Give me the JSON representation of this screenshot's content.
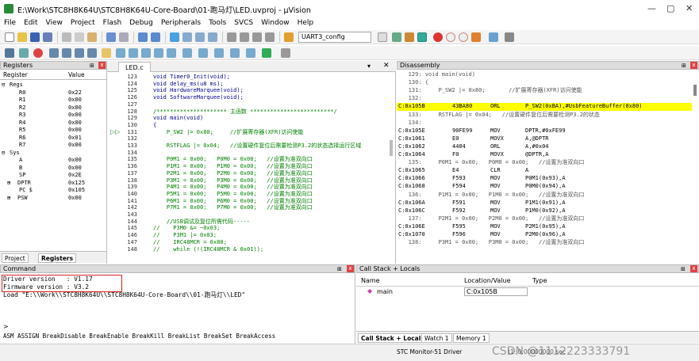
{
  "window": {
    "title": "E:\\Work\\STC8H8K64U\\STC8H8K64U-Core-Board\\01-跑马灯\\LED.uvproj - µVision"
  },
  "menu": [
    "File",
    "Edit",
    "View",
    "Project",
    "Flash",
    "Debug",
    "Peripherals",
    "Tools",
    "SVCS",
    "Window",
    "Help"
  ],
  "toolbar": {
    "target": "UART3_config"
  },
  "registers": {
    "title": "Registers",
    "col_register": "Register",
    "col_value": "Value",
    "rows": [
      {
        "name": "Regs",
        "value": "",
        "indent": 0,
        "prefix": "⊟"
      },
      {
        "name": "R0",
        "value": "0x22",
        "indent": 2
      },
      {
        "name": "R1",
        "value": "0x00",
        "indent": 2
      },
      {
        "name": "R2",
        "value": "0x00",
        "indent": 2
      },
      {
        "name": "R3",
        "value": "0x00",
        "indent": 2
      },
      {
        "name": "R4",
        "value": "0x00",
        "indent": 2
      },
      {
        "name": "R5",
        "value": "0x00",
        "indent": 2
      },
      {
        "name": "R6",
        "value": "0x01",
        "indent": 2
      },
      {
        "name": "R7",
        "value": "0x00",
        "indent": 2
      },
      {
        "name": "Sys",
        "value": "",
        "indent": 0,
        "prefix": "⊟"
      },
      {
        "name": "A",
        "value": "0x00",
        "indent": 2
      },
      {
        "name": "B",
        "value": "0x00",
        "indent": 2
      },
      {
        "name": "SP",
        "value": "0x2E",
        "indent": 2
      },
      {
        "name": "DPTR",
        "value": "0x125",
        "indent": 1,
        "prefix": "⊞"
      },
      {
        "name": "PC $",
        "value": "0x105",
        "indent": 2
      },
      {
        "name": "PSW",
        "value": "0x00",
        "indent": 1,
        "prefix": "⊞"
      }
    ],
    "tab_project": "Project",
    "tab_registers": "Registers"
  },
  "editor": {
    "tab": "LED.c",
    "lines": [
      {
        "n": "123",
        "t": "void Timer0_Init(void);"
      },
      {
        "n": "124",
        "t": "void delay_ms(u8 ms);"
      },
      {
        "n": "125",
        "t": "void HardwareMarquee(void);"
      },
      {
        "n": "126",
        "t": "void SoftwareMarquee(void);"
      },
      {
        "n": "127",
        "t": ""
      },
      {
        "n": "128",
        "t": "/********************* 主函数 *************************/"
      },
      {
        "n": "129",
        "t": "void main(void)"
      },
      {
        "n": "130",
        "t": "{"
      },
      {
        "n": "131",
        "t": "    P_SW2 |= 0x80;     //扩展寄存器(XFR)访问使能"
      },
      {
        "n": "132",
        "t": ""
      },
      {
        "n": "133",
        "t": "    RSTFLAG |= 0x04;   //设置硬件复位后需要检测P3.2的状态选择运行区域"
      },
      {
        "n": "134",
        "t": ""
      },
      {
        "n": "135",
        "t": "    P0M1 = 0x00;   P0M0 = 0x00;   //设置为准双向口"
      },
      {
        "n": "136",
        "t": "    P1M1 = 0x00;   P1M0 = 0x00;   //设置为准双向口"
      },
      {
        "n": "137",
        "t": "    P2M1 = 0x00;   P2M0 = 0x00;   //设置为准双向口"
      },
      {
        "n": "138",
        "t": "    P3M1 = 0x00;   P3M0 = 0x00;   //设置为准双向口"
      },
      {
        "n": "139",
        "t": "    P4M1 = 0x00;   P4M0 = 0x00;   //设置为准双向口"
      },
      {
        "n": "140",
        "t": "    P5M1 = 0x00;   P5M0 = 0x00;   //设置为准双向口"
      },
      {
        "n": "141",
        "t": "    P6M1 = 0x00;   P6M0 = 0x00;   //设置为准双向口"
      },
      {
        "n": "142",
        "t": "    P7M1 = 0x00;   P7M0 = 0x00;   //设置为准双向口"
      },
      {
        "n": "143",
        "t": ""
      },
      {
        "n": "144",
        "t": "    //USB调试及复位所需代码-----"
      },
      {
        "n": "145",
        "t": "//    P3M0 &= ~0x03;"
      },
      {
        "n": "146",
        "t": "//    P3M1 |= 0x03;"
      },
      {
        "n": "147",
        "t": "//    IRC48MCR = 0x80;"
      },
      {
        "n": "148",
        "t": "//    while (!(IRC48MCR & 0x01));"
      }
    ]
  },
  "disassembly": {
    "title": "Disassembly",
    "lines": [
      {
        "src": "   129: void main(void)"
      },
      {
        "src": "   130: {"
      },
      {
        "src": "   131:     P_SW2 |= 0x80;       //扩展寄存器(XFR)访问使能"
      },
      {
        "src": "   132:"
      },
      {
        "a": "C:0x105B",
        "h": "43BA80",
        "m": "ORL",
        "o": "P_SW2(0xBA),#UsbFeatureBuffer(0x80)",
        "hl": true
      },
      {
        "src": "   133:     RSTFLAG |= 0x04;   //设置硬件复位后需要检测P3.2的状态"
      },
      {
        "src": "   134:"
      },
      {
        "a": "C:0x105E",
        "h": "90FE99",
        "m": "MOV",
        "o": "DPTR,#0xFE99"
      },
      {
        "a": "C:0x1061",
        "h": "E0",
        "m": "MOVX",
        "o": "A,@DPTR"
      },
      {
        "a": "C:0x1062",
        "h": "4404",
        "m": "ORL",
        "o": "A,#0x04"
      },
      {
        "a": "C:0x1064",
        "h": "F0",
        "m": "MOVX",
        "o": "@DPTR,A"
      },
      {
        "src": "   135:     P0M1 = 0x00;   P0M0 = 0x00;   //设置为准双向口"
      },
      {
        "a": "C:0x1065",
        "h": "E4",
        "m": "CLR",
        "o": "A"
      },
      {
        "a": "C:0x1066",
        "h": "F593",
        "m": "MOV",
        "o": "P0M1(0x93),A"
      },
      {
        "a": "C:0x1068",
        "h": "F594",
        "m": "MOV",
        "o": "P0M0(0x94),A"
      },
      {
        "src": "   136:     P1M1 = 0x00;   P1M0 = 0x00;   //设置为准双向口"
      },
      {
        "a": "C:0x106A",
        "h": "F591",
        "m": "MOV",
        "o": "P1M1(0x91),A"
      },
      {
        "a": "C:0x106C",
        "h": "F592",
        "m": "MOV",
        "o": "P1M0(0x92),A"
      },
      {
        "src": "   137:     P2M1 = 0x00;   P2M0 = 0x00;   //设置为准双向口"
      },
      {
        "a": "C:0x106E",
        "h": "F595",
        "m": "MOV",
        "o": "P2M1(0x95),A"
      },
      {
        "a": "C:0x1070",
        "h": "F596",
        "m": "MOV",
        "o": "P2M0(0x96),A"
      },
      {
        "src": "   138:     P3M1 = 0x00;   P3M0 = 0x00;   //设置为准双向口"
      }
    ]
  },
  "command": {
    "title": "Command",
    "output": [
      "Driver version   : V1.17",
      "Firmware version : V3.2",
      "Load \"E:\\\\Work\\\\STC8H8K64U\\\\STC8H8K64U-Core-Board\\\\01-跑马灯\\\\LED\""
    ],
    "prompt": ">",
    "hints": "ASM ASSIGN BreakDisable BreakEnable BreakKill BreakList BreakSet BreakAccess"
  },
  "callstack": {
    "title": "Call Stack + Locals",
    "col_name": "Name",
    "col_location": "Location/Value",
    "col_type": "Type",
    "row_name": "main",
    "row_location": "C:0x105B",
    "tab_callstack": "Call Stack + Locals",
    "tab_watch": "Watch 1",
    "tab_memory": "Memory 1"
  },
  "status": {
    "driver": "STC Monitor-51 Driver",
    "time": "t1: 0.00000000 sec",
    "watermark": "CSDN @1112223333791"
  },
  "colors": {
    "highlight": "#ffff00",
    "comment": "#008000",
    "keyword": "#00008b",
    "redbox": "#dd2222"
  }
}
